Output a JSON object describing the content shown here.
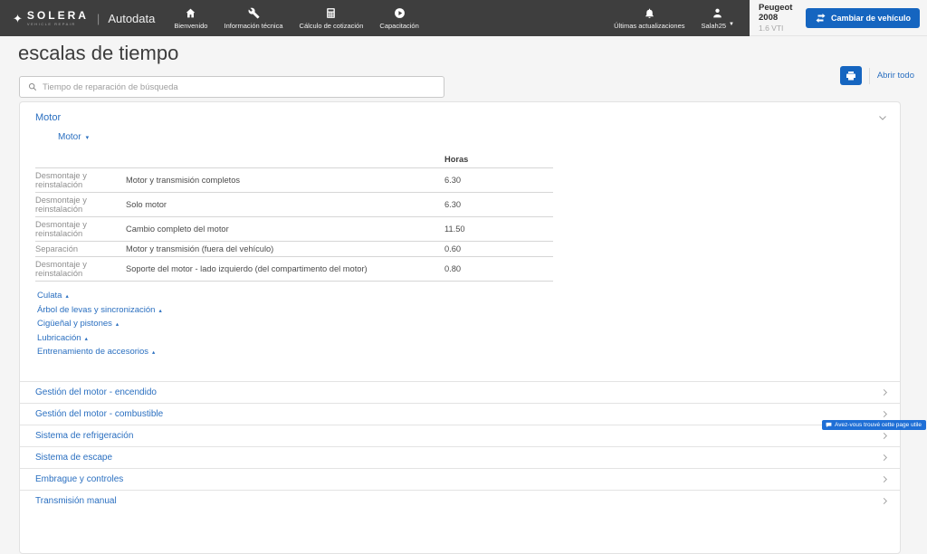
{
  "header": {
    "logo": {
      "brand": "SOLERA",
      "sub": "VEHICLE REPAIR",
      "product": "Autodata"
    },
    "nav": [
      {
        "label": "Bienvenido",
        "icon": "home-icon"
      },
      {
        "label": "Información técnica",
        "icon": "wrench-icon"
      },
      {
        "label": "Cálculo de cotización",
        "icon": "calculator-icon"
      },
      {
        "label": "Capacitación",
        "icon": "play-circle-icon"
      }
    ],
    "right_nav": [
      {
        "label": "Últimas actualizaciones",
        "icon": "bell-icon"
      },
      {
        "label": "Salah25",
        "icon": "user-icon",
        "caret": "▼"
      }
    ],
    "vehicle": {
      "make": "Peugeot",
      "model": "2008",
      "engine": "1.6 VTI"
    },
    "change_vehicle_button": "Cambiar de vehículo"
  },
  "page": {
    "title": "escalas de tiempo",
    "search_placeholder": "Tiempo de reparación de búsqueda",
    "open_all_label": "Abrir todo"
  },
  "motor_section": {
    "title": "Motor",
    "subgroup": "Motor",
    "table": {
      "hours_header": "Horas",
      "rows": [
        {
          "action": "Desmontaje y reinstalación",
          "description": "Motor y transmisión completos",
          "hours": "6.30"
        },
        {
          "action": "Desmontaje y reinstalación",
          "description": "Solo motor",
          "hours": "6.30"
        },
        {
          "action": "Desmontaje y reinstalación",
          "description": "Cambio completo del motor",
          "hours": "11.50"
        },
        {
          "action": "Separación",
          "description": "Motor y transmisión (fuera del vehículo)",
          "hours": "0.60"
        },
        {
          "action": "Desmontaje y reinstalación",
          "description": "Soporte del motor - lado izquierdo (del compartimento del motor)",
          "hours": "0.80"
        }
      ]
    },
    "sublinks": [
      "Culata",
      "Árbol de levas y sincronización",
      "Cigüeñal y pistones",
      "Lubricación",
      "Entrenamiento de accesorios"
    ]
  },
  "sections": [
    "Gestión del motor - encendido",
    "Gestión del motor - combustible",
    "Sistema de refrigeración",
    "Sistema de escape",
    "Embrague y controles",
    "Transmisión manual"
  ],
  "feedback_banner": "Avez-vous trouvé cette page utile",
  "colors": {
    "header_bg": "#3e3e3e",
    "accent_blue": "#1565c0",
    "link_blue": "#2a6fc0",
    "page_bg": "#f5f5f5"
  }
}
